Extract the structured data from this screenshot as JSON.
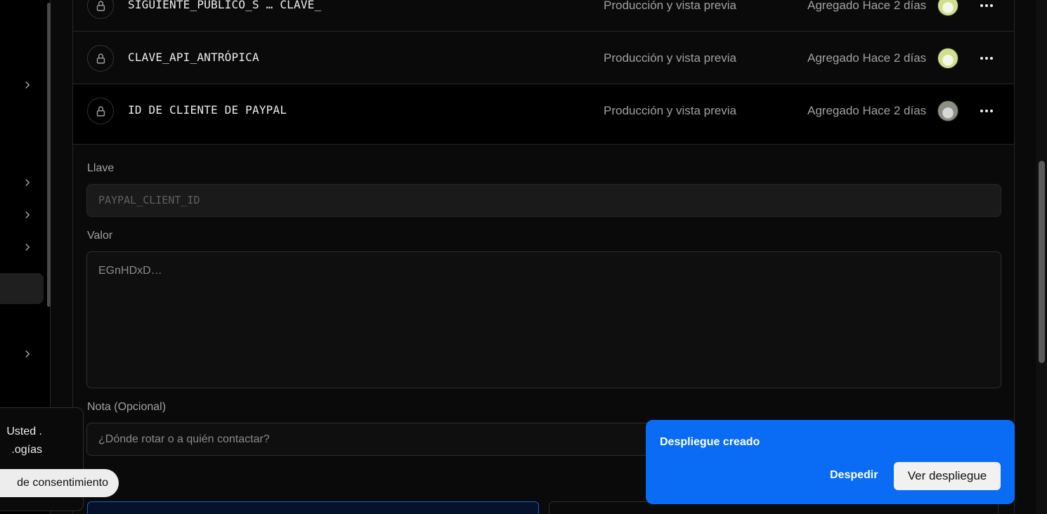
{
  "env_vars": [
    {
      "key": "SIGUIENTE_PÚBLICO_S … CLAVE_",
      "environments": "Producción y vista previa",
      "added": "Agregado Hace 2 días"
    },
    {
      "key": "CLAVE_API_ANTRÓPICA",
      "environments": "Producción y vista previa",
      "added": "Agregado Hace 2 días"
    },
    {
      "key": "ID DE CLIENTE DE PAYPAL",
      "environments": "Producción y vista previa",
      "added": "Agregado Hace 2 días"
    }
  ],
  "form": {
    "key_label": "Llave",
    "key_value": "PAYPAL_CLIENT_ID",
    "value_label": "Valor",
    "value_text": "EGnHDxD…",
    "note_label": "Nota (Opcional)",
    "note_placeholder": "¿Dónde rotar o a quién contactar?"
  },
  "consent": {
    "line1": ". Usted",
    "line2": "ogías.",
    "button": "de consentimiento"
  },
  "toast": {
    "title": "Despliegue creado",
    "dismiss": "Despedir",
    "view": "Ver despliegue",
    "color": "#0a6cf5"
  },
  "icons": {
    "lock": "lock-icon",
    "chevron": "chevron-right-icon",
    "more": "more-horizontal-icon"
  }
}
